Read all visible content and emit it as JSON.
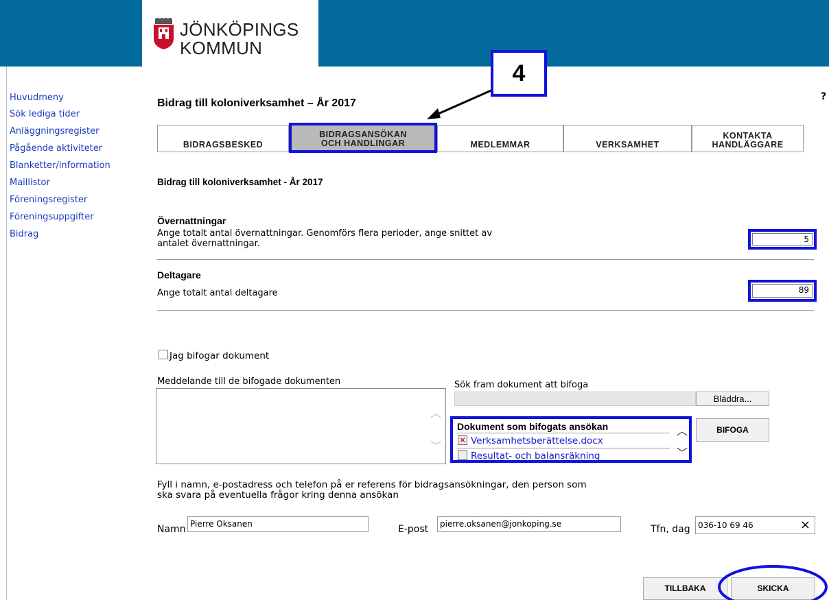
{
  "header": {
    "logo_line1": "JÖNKÖPINGS",
    "logo_line2": "KOMMUN",
    "brand_color": "#036a9c"
  },
  "sidebar": {
    "items": [
      {
        "label": "Huvudmeny"
      },
      {
        "label": "Sök lediga tider"
      },
      {
        "label": "Anläggningsregister"
      },
      {
        "label": "Pågående aktiviteter"
      },
      {
        "label": "Blanketter/information"
      },
      {
        "label": "Maillistor"
      },
      {
        "label": "Föreningsregister"
      },
      {
        "label": "Föreningsuppgifter"
      },
      {
        "label": "Bidrag"
      }
    ]
  },
  "page": {
    "title": "Bidrag till koloniverksamhet – År 2017",
    "help": "?"
  },
  "callout": {
    "number": "4"
  },
  "tabs": [
    {
      "label": "BIDRAGSBESKED"
    },
    {
      "label": "BIDRAGSANSÖKAN OCH HANDLINGAR",
      "line1": "BIDRAGSANSÖKAN",
      "line2": "OCH HANDLINGAR",
      "active": true
    },
    {
      "label": "MEDLEMMAR"
    },
    {
      "label": "VERKSAMHET"
    },
    {
      "label": "KONTAKTA HANDLÄGGARE",
      "line1": "KONTAKTA",
      "line2": "HANDLÄGGARE"
    }
  ],
  "form": {
    "heading": "Bidrag till koloniverksamhet - År 2017",
    "overnight": {
      "title": "Övernattningar",
      "desc1": "Ange totalt antal övernattningar. Genomförs flera perioder, ange snittet av",
      "desc2": "antalet övernattningar.",
      "value": "5"
    },
    "participants": {
      "title": "Deltagare",
      "desc": "Ange totalt antal deltagare",
      "value": "89"
    },
    "attach_checkbox": "Jag bifogar dokument",
    "message_label": "Meddelande till de bifogade dokumenten",
    "search_label": "Sök fram dokument att bifoga",
    "browse_button": "Bläddra...",
    "attached_title": "Dokument som bifogats ansökan",
    "attached_docs": [
      "Verksamhetsberättelse.docx",
      "Resultat- och balansräkning"
    ],
    "attach_button": "BIFOGA",
    "contact_info1": "Fyll i namn, e-postadress och telefon på er referens för bidragsansökningar, den person som",
    "contact_info2": "ska svara på eventuella frågor kring denna ansökan",
    "name_label": "Namn",
    "name_value": "Pierre Oksanen",
    "email_label": "E-post",
    "email_value": "pierre.oksanen@jonkoping.se",
    "phone_label": "Tfn, dag",
    "phone_value": "036-10 69 46",
    "clear_icon": "×",
    "back_button": "TILLBAKA",
    "send_button": "SKICKA"
  },
  "highlight_color": "#1212dd"
}
